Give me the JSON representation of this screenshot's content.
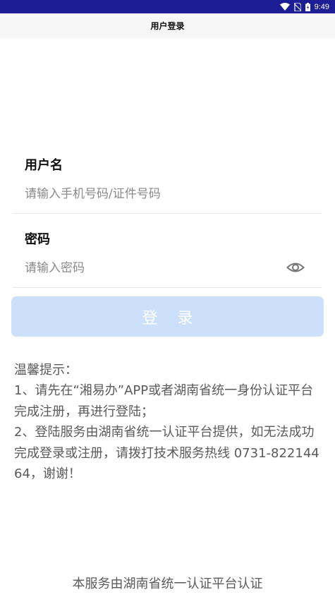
{
  "status_bar": {
    "time": "9:49",
    "icons": [
      "wifi-icon",
      "no-sim-icon",
      "battery-icon"
    ]
  },
  "header": {
    "title": "用户登录"
  },
  "form": {
    "username": {
      "label": "用户名",
      "placeholder": "请输入手机号码/证件号码",
      "value": ""
    },
    "password": {
      "label": "密码",
      "placeholder": "请输入密码",
      "value": "",
      "toggle_icon": "eye-icon"
    },
    "login_button": "登录"
  },
  "tips": {
    "title": "温馨提示：",
    "items": [
      "1、请先在“湘易办”APP或者湖南省统一身份认证平台完成注册，再进行登陆；",
      "2、登陆服务由湖南省统一认证平台提供，如无法成功完成登录或注册，请拨打技术服务热线 0731-82214464，谢谢！"
    ]
  },
  "footer": "本服务由湖南省统一认证平台认证",
  "colors": {
    "status_bar": "#1d1d96",
    "title_bar": "#f7f7f7",
    "button_disabled": "#cde0fb",
    "tip_text": "#5a5a5a"
  }
}
